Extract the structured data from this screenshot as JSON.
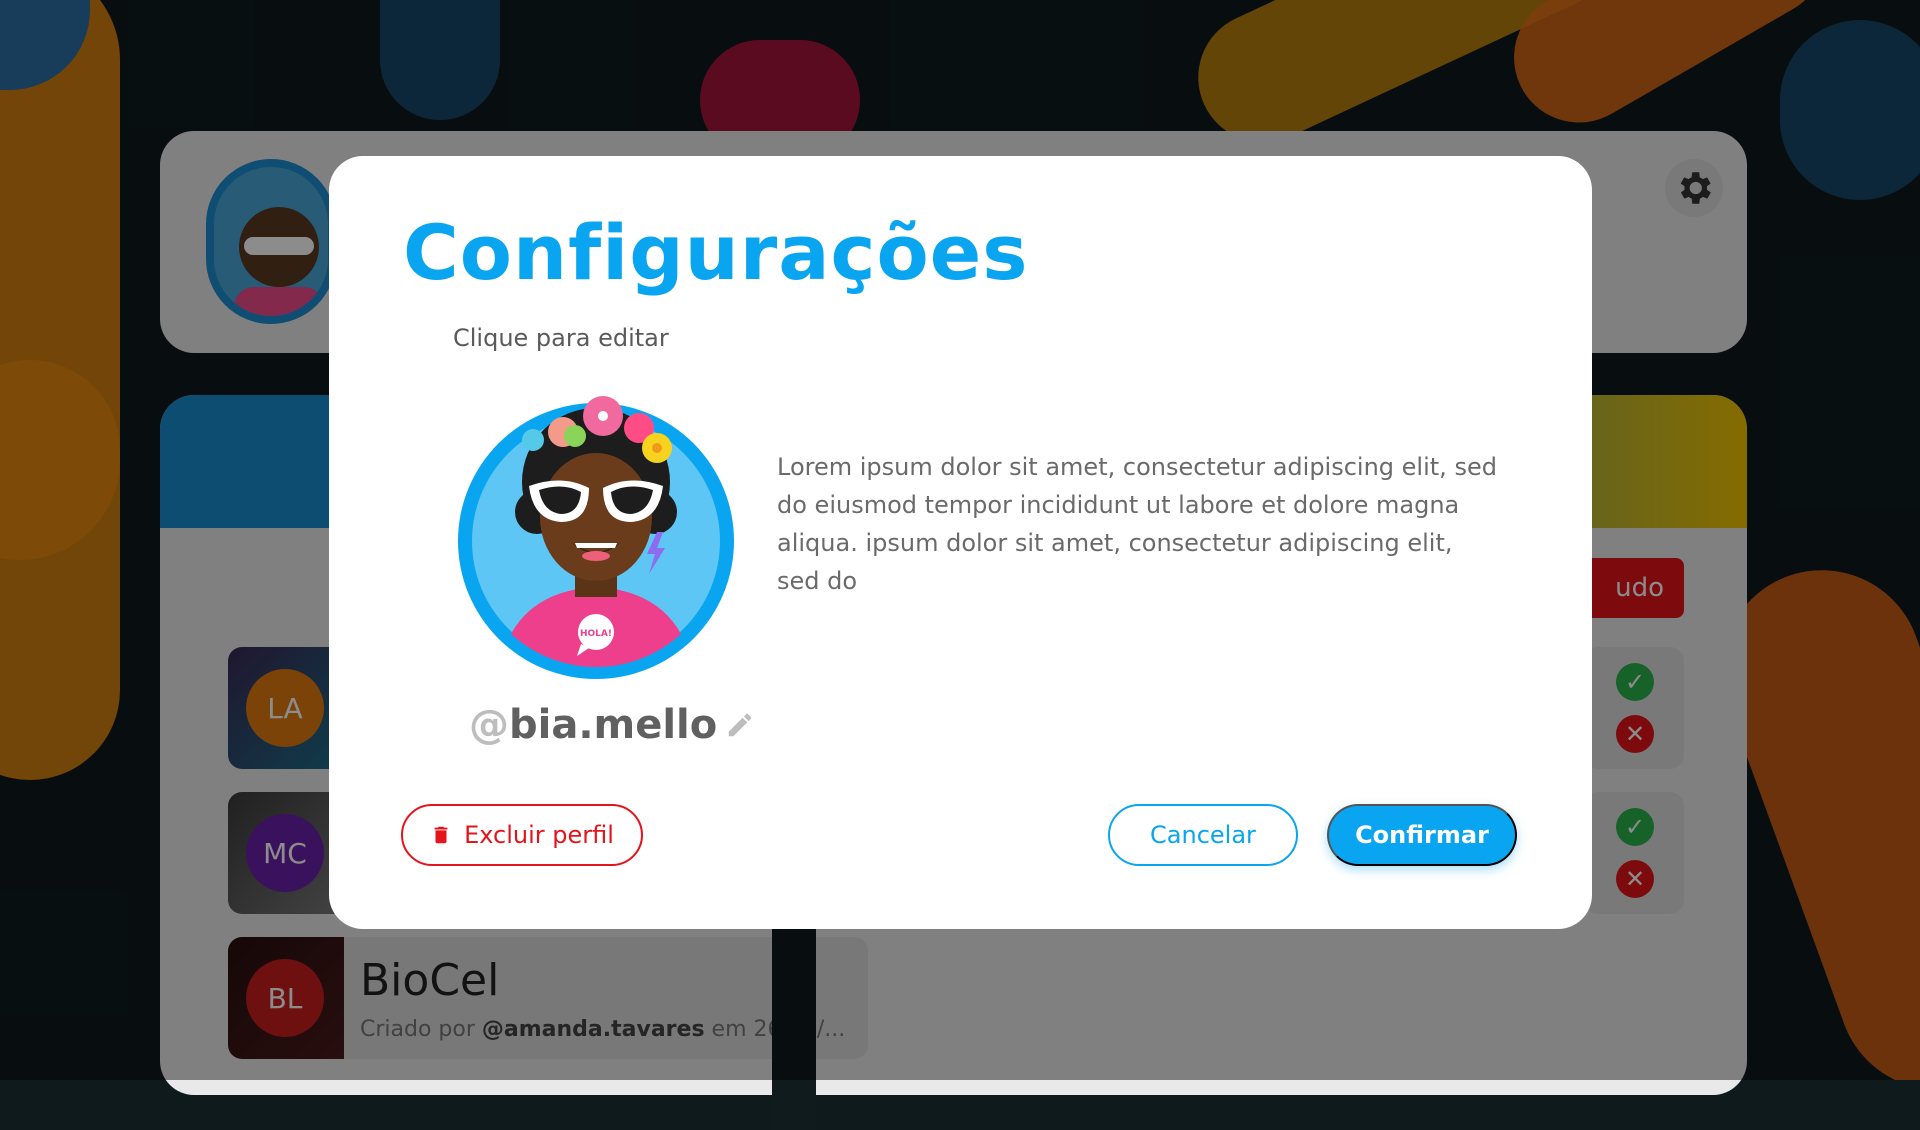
{
  "background_app": {
    "header": {
      "settings_icon": "gear-icon"
    },
    "panel": {
      "action_button_label": "udo",
      "groups": [
        {
          "initials": "LA",
          "color": "#e07a10"
        },
        {
          "initials": "MC",
          "color": "#6a1fa8"
        },
        {
          "initials": "BL",
          "color": "#c81e1e",
          "name": "BioCel",
          "meta_prefix": "Criado por ",
          "meta_user": "@amanda.tavares",
          "meta_suffix": " em 26/03/..."
        }
      ]
    }
  },
  "modal": {
    "title": "Configurações",
    "hint": "Clique para editar",
    "username_at": "@",
    "username": "bia.mello",
    "edit_icon": "pencil-icon",
    "bio": "Lorem ipsum dolor sit amet, consectetur adipiscing elit, sed do eiusmod tempor incididunt ut labore et dolore magna aliqua.  ipsum dolor sit amet, consectetur adipiscing elit, sed do",
    "delete_label": "Excluir perfil",
    "delete_icon": "trash-icon",
    "cancel_label": "Cancelar",
    "confirm_label": "Confirmar",
    "speech_bubble_text": "HOLA!"
  },
  "colors": {
    "primary": "#0aa5f0",
    "danger": "#e4141b",
    "accept": "#2bb34a"
  }
}
